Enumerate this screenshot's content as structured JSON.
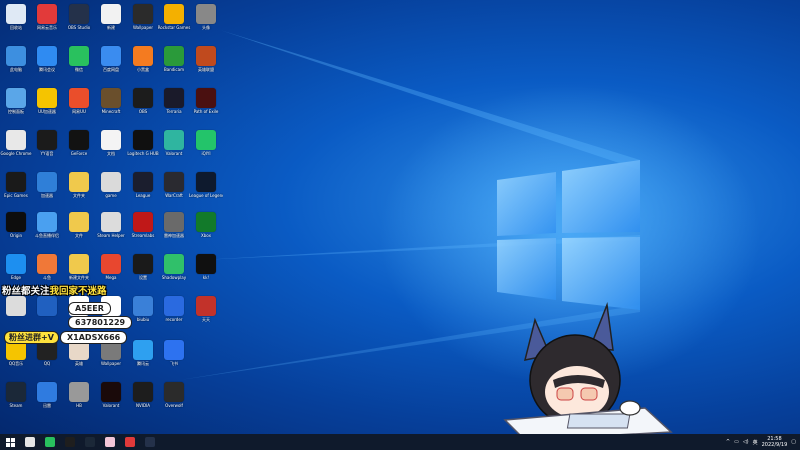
{
  "desktop": {
    "icons": [
      {
        "label": "回收站",
        "color": "#dfe9f5"
      },
      {
        "label": "网易云音乐",
        "color": "#e23a3a"
      },
      {
        "label": "OBS Studio",
        "color": "#24314a"
      },
      {
        "label": "新建",
        "color": "#f2f2f2"
      },
      {
        "label": "Wallpaper",
        "color": "#2b2b2b"
      },
      {
        "label": "Rockstar Games",
        "color": "#f4b000"
      },
      {
        "label": "头像",
        "color": "#888888"
      },
      {
        "label": "此电脑",
        "color": "#3d8fe0"
      },
      {
        "label": "腾讯会议",
        "color": "#2f8bf2"
      },
      {
        "label": "微信",
        "color": "#29c15e"
      },
      {
        "label": "百度网盘",
        "color": "#3a8cf0"
      },
      {
        "label": "小黑盒",
        "color": "#f47b20"
      },
      {
        "label": "Bandicam",
        "color": "#2a9a3a"
      },
      {
        "label": "英雄联盟",
        "color": "#c04a1e"
      },
      {
        "label": "控制面板",
        "color": "#5aa6e8"
      },
      {
        "label": "UU加速器",
        "color": "#f5c400"
      },
      {
        "label": "网易UU",
        "color": "#ea4e2b"
      },
      {
        "label": "Minecraft",
        "color": "#6a4f2c"
      },
      {
        "label": "OBS",
        "color": "#1c1c1c"
      },
      {
        "label": "Terraria",
        "color": "#1a1a2a"
      },
      {
        "label": "Path of Exile",
        "color": "#4a1010"
      },
      {
        "label": "Google Chrome",
        "color": "#e8e8e8"
      },
      {
        "label": "YY语音",
        "color": "#1b1b1b"
      },
      {
        "label": "GeForce",
        "color": "#121212"
      },
      {
        "label": "文档",
        "color": "#f4f4f4"
      },
      {
        "label": "Logitech G HUB",
        "color": "#101010"
      },
      {
        "label": "Valorant",
        "color": "#2fb5a0"
      },
      {
        "label": "iQIYI",
        "color": "#23c46a"
      },
      {
        "label": "Epic Games",
        "color": "#1a1a1a"
      },
      {
        "label": "加速器",
        "color": "#2f7fd8"
      },
      {
        "label": "文件夹",
        "color": "#f0c94c"
      },
      {
        "label": "game",
        "color": "#dadada"
      },
      {
        "label": "League",
        "color": "#1b1e2e"
      },
      {
        "label": "WarCraft",
        "color": "#2a2a30"
      },
      {
        "label": "League of Legends",
        "color": "#0e1a2e"
      },
      {
        "label": "Origin",
        "color": "#0d0d0d"
      },
      {
        "label": "斗鱼直播伴侣",
        "color": "#4aa0f0"
      },
      {
        "label": "文件",
        "color": "#f0c94c"
      },
      {
        "label": "Steam Helper",
        "color": "#dcdcdc"
      },
      {
        "label": "Streamlabs",
        "color": "#c01818"
      },
      {
        "label": "雷神加速器",
        "color": "#6a6a6a"
      },
      {
        "label": "Xbox",
        "color": "#127a2a"
      },
      {
        "label": "Edge",
        "color": "#1d8ff0"
      },
      {
        "label": "斗鱼",
        "color": "#f07838"
      },
      {
        "label": "新建文件夹",
        "color": "#f0c94c"
      },
      {
        "label": "Mega",
        "color": "#e8472f"
      },
      {
        "label": "设置",
        "color": "#1a1a1a"
      },
      {
        "label": "Shadowplay",
        "color": "#30c06a"
      },
      {
        "label": "kk!",
        "color": "#101010"
      },
      {
        "label": "",
        "color": "#dcdcdc"
      },
      {
        "label": "",
        "color": "#2060c0"
      },
      {
        "label": "",
        "color": "#ffffff"
      },
      {
        "label": "",
        "color": "#ffffff"
      },
      {
        "label": "biubiu",
        "color": "#3a80d8"
      },
      {
        "label": "recorder",
        "color": "#2a6ae0"
      },
      {
        "label": "天天",
        "color": "#c2322a"
      },
      {
        "label": "QQ音乐",
        "color": "#f5c400"
      },
      {
        "label": "QQ",
        "color": "#222222"
      },
      {
        "label": "英雄",
        "color": "#e8d8c8"
      },
      {
        "label": "Wallpaper",
        "color": "#7a7a7a"
      },
      {
        "label": "腾讯云",
        "color": "#2ea0f0"
      },
      {
        "label": "飞书",
        "color": "#2d72f0"
      },
      {
        "label": "Steam",
        "color": "#1b2838"
      },
      {
        "label": "迅雷",
        "color": "#2f7be0"
      },
      {
        "label": "HB",
        "color": "#999999"
      },
      {
        "label": "Valorant",
        "color": "#1a0a0a"
      },
      {
        "label": "NVIDIA",
        "color": "#1d1d1d"
      },
      {
        "label": "Overwolf",
        "color": "#2b2b2b"
      }
    ]
  },
  "overlay": {
    "headline_white": "粉丝都关注",
    "headline_yellow": "我回家不迷路",
    "qq_label": "A5EER",
    "qq_number": "637801229",
    "tag_text": "粉丝进群+V",
    "wechat_id": "X1ADSX666"
  },
  "taskbar": {
    "start_icon": "windows-start-icon",
    "pinned": [
      {
        "name": "chrome-icon",
        "color": "#e6e6e6"
      },
      {
        "name": "wechat-icon",
        "color": "#29c15e"
      },
      {
        "name": "ai-app-icon",
        "color": "#1e1e1e"
      },
      {
        "name": "steam-icon",
        "color": "#1b2838"
      },
      {
        "name": "app-icon",
        "color": "#f3c6d8"
      },
      {
        "name": "app-icon-2",
        "color": "#e23a3a"
      },
      {
        "name": "obs-icon",
        "color": "#24314a"
      }
    ],
    "clock_time": "21:58",
    "clock_date": "2022/9/19"
  }
}
